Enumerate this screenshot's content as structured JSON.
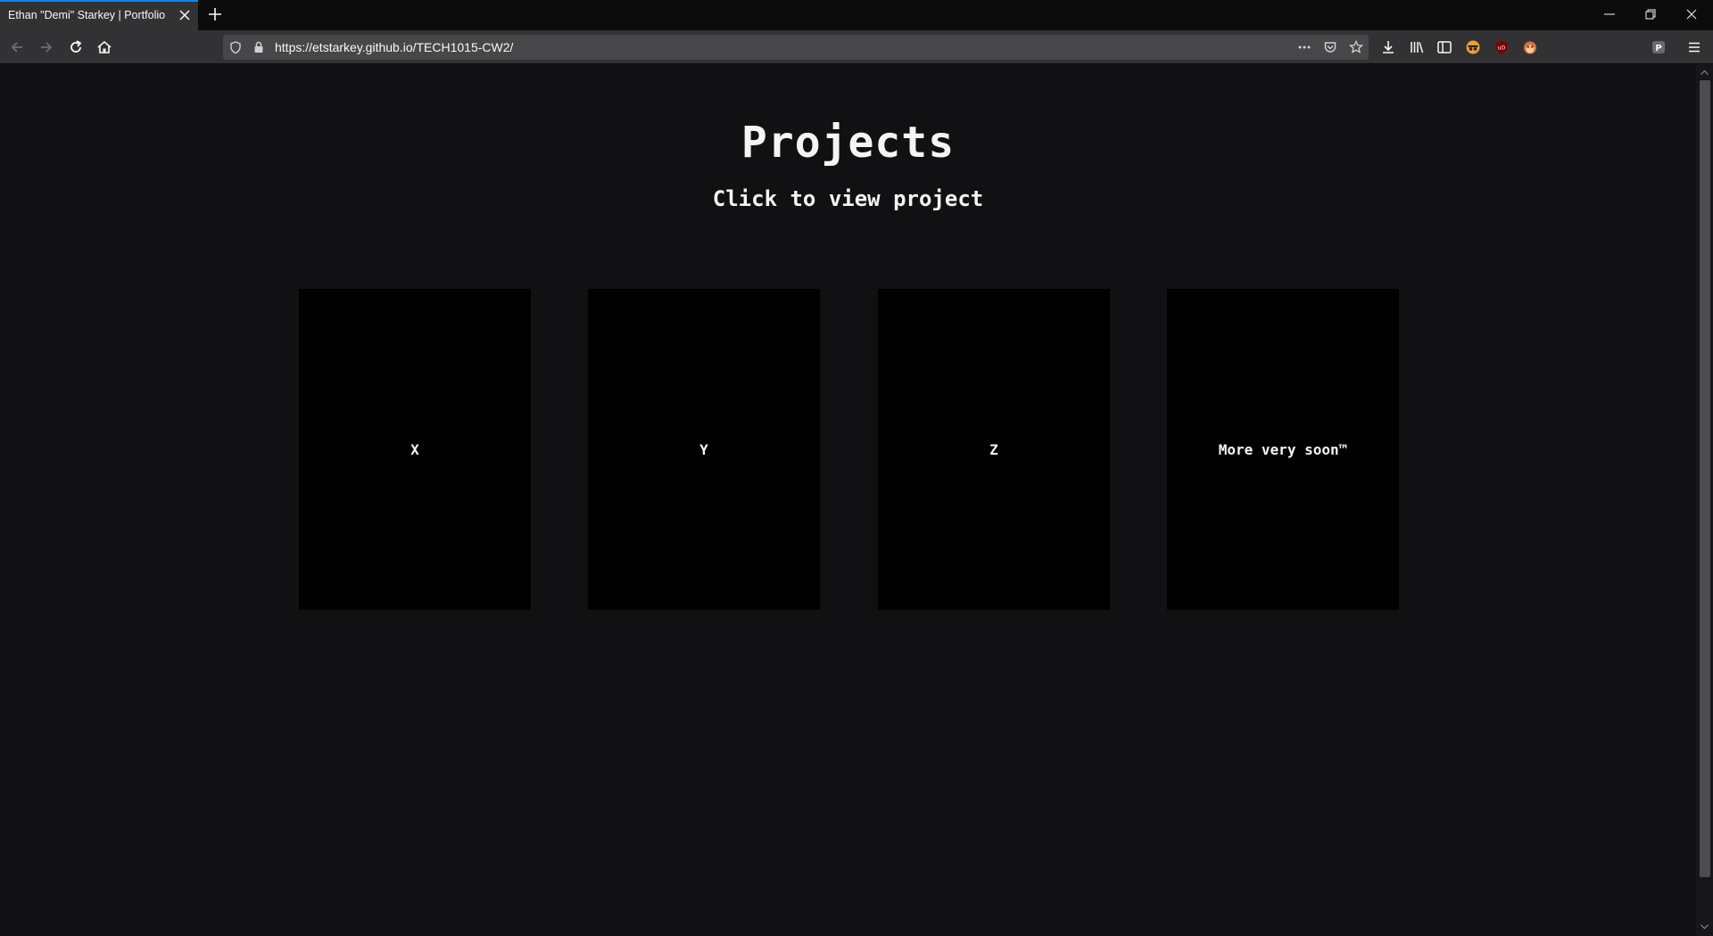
{
  "browser": {
    "tab_title": "Ethan \"Demi\" Starkey | Portfolio",
    "url": "https://etstarkey.github.io/TECH1015-CW2/",
    "accent_color": "#0a84ff"
  },
  "page": {
    "title": "Projects",
    "subtitle": "Click to view project",
    "cards": [
      {
        "label": "X"
      },
      {
        "label": "Y"
      },
      {
        "label": "Z"
      },
      {
        "label": "More very soon™"
      }
    ]
  },
  "colors": {
    "background": "#111113",
    "card": "#000000",
    "text": "#f5f5f5"
  }
}
